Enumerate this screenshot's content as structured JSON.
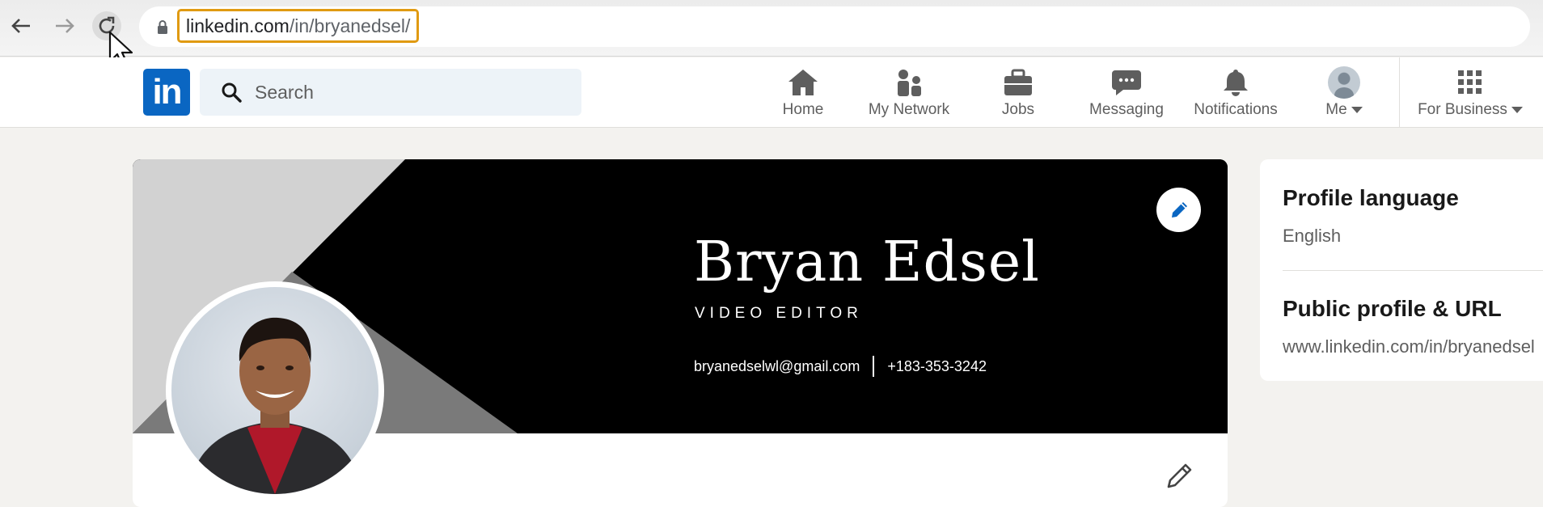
{
  "browser": {
    "url_host": "linkedin.com",
    "url_path": "/in/bryanedsel/"
  },
  "nav": {
    "search_placeholder": "Search",
    "items": [
      {
        "label": "Home",
        "icon": "home-icon"
      },
      {
        "label": "My Network",
        "icon": "network-icon"
      },
      {
        "label": "Jobs",
        "icon": "briefcase-icon"
      },
      {
        "label": "Messaging",
        "icon": "messaging-icon"
      },
      {
        "label": "Notifications",
        "icon": "bell-icon"
      },
      {
        "label": "Me",
        "icon": "avatar-icon"
      },
      {
        "label": "For Business",
        "icon": "grid-icon"
      }
    ]
  },
  "banner": {
    "name": "Bryan Edsel",
    "title": "VIDEO EDITOR",
    "email": "bryanedselwl@gmail.com",
    "phone": "+183-353-3242"
  },
  "sidebar": {
    "language_title": "Profile language",
    "language_value": "English",
    "public_title": "Public profile & URL",
    "public_value": "www.linkedin.com/in/bryanedsel"
  },
  "colors": {
    "linkedin_blue": "#0a66c2",
    "url_highlight": "#e09a12",
    "page_bg": "#f3f2ef"
  }
}
